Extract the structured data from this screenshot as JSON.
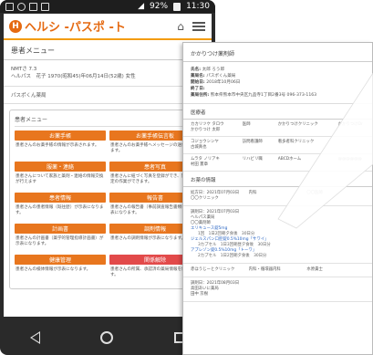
{
  "status_bar": {
    "battery": "92%",
    "time": "11:30"
  },
  "app": {
    "logo_text": "ヘルシ -パスポ -ト",
    "logo_mark": "H",
    "page_title": "患者メニュー",
    "patient": {
      "line1": "NMTさ 7.3",
      "line2": "ヘルパス　花子 1970(昭和45)年06月14日(52歳) 女性"
    },
    "pharmacy_name": "パスポくん薬局",
    "menu_box_title": "患者メニュー",
    "menu_items": [
      {
        "label": "お薬手帳",
        "desc": "患者さんのお薬手帳の情報が示表されます。",
        "color": "orange"
      },
      {
        "label": "お薬手帳伝言板",
        "desc": "患者さんのお薬手帳へメッセージの送信が行えます。",
        "color": "orange"
      },
      {
        "label": "服薬・連絡",
        "desc": "患者さんについて家族と薬剤・連絡の情報交換が行えます",
        "color": "orange"
      },
      {
        "label": "患者写真",
        "desc": "患者さんに紐づく写真を登録ができ、閲覧と予定の作業ができます。",
        "color": "orange"
      },
      {
        "label": "患者情報",
        "desc": "患者さんの患者情報（既往歴）が示表になります。",
        "color": "orange"
      },
      {
        "label": "報告書",
        "desc": "患者さんの報告書（事前調査報告書類等）が示表になります。",
        "color": "orange"
      },
      {
        "label": "計画書",
        "desc": "患者さんの計画書（薬学的管理指導計画書）が示表になります。",
        "color": "orange"
      },
      {
        "label": "調剤情報",
        "desc": "患者さんの調剤情報が示表になります。",
        "color": "orange"
      },
      {
        "label": "健康管理",
        "desc": "患者さんの検体情報が示表になります。",
        "color": "orange"
      },
      {
        "label": "関係解除",
        "desc": "患者さんの所属、承認済の薬局情報を解除します。",
        "color": "red"
      }
    ]
  },
  "document": {
    "title": "かかりつけ薬剤師",
    "info_rows": [
      {
        "label": "氏名:",
        "value": "太郎 ろう郎"
      },
      {
        "label": "薬局名:",
        "value": "パスポくん薬局"
      },
      {
        "label": "開始日:",
        "value": "2018年10月06日"
      },
      {
        "label": "終了日:",
        "value": ""
      },
      {
        "label": "薬局住所:",
        "value": "熊本県熊本市中央区九品寺1丁目2番3号 096-373-1163"
      }
    ],
    "doctor_section": "医療者",
    "doctors": [
      [
        "カカリツケ タロウ\nかかりつけ 太郎",
        "医師",
        "かかりつけクリニック",
        "かかりつけDr"
      ],
      [
        "コジョウシンヤ\n古城真也",
        "訪問看護師",
        "看多者科クリニック",
        ""
      ],
      [
        "ムラタ ノリアキ\n村田 憲章",
        "リハビリ職",
        "ABCDホーム",
        "@@@@@@"
      ]
    ],
    "visits_section": "お薬の情報",
    "visits": [
      {
        "date": "処方日：2021年07月03日",
        "clinic": "〇〇クリニック",
        "dept": "内科",
        "doctor": "〇〇医師",
        "drugs": []
      },
      {
        "date": "調剤日：2021年07月03日",
        "clinic": "ヘルパス薬局\n〇〇薬剤師",
        "dept": "",
        "doctor": "",
        "drugs": [
          {
            "name": "エリキュース錠5mg",
            "detail": "1回　1日2回朝夕食後　30日分"
          },
          {
            "name": "ジェルスパン口腔錠0.5%10mg「サワイ」",
            "detail": "3カプセル　1日3回朝昼夕食後　30日分"
          },
          {
            "name": "アプレゾン錠0.5%10mg「トーワ」",
            "detail": "2カプセル　1日2回朝夕食後　30日分"
          }
        ]
      },
      {
        "date": "赤ほうじーとクリニック",
        "clinic": "",
        "dept": "内科・循環器内科",
        "doctor": "水原貴士",
        "drugs": []
      },
      {
        "date": "調剤日：2021年08月03日",
        "clinic": "高田あいに薬局\n田中 京樹",
        "dept": "",
        "doctor": "",
        "drugs": []
      }
    ]
  },
  "colors": {
    "accent": "#e8761e",
    "danger": "#e24a4a",
    "link": "#2b66c3"
  }
}
